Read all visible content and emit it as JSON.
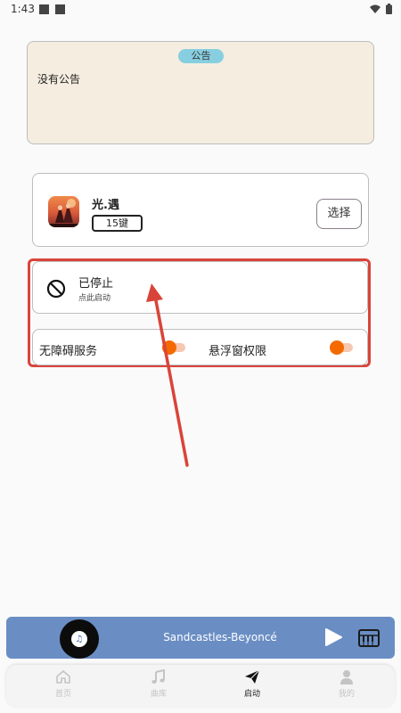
{
  "status_bar": {
    "time": "1:43"
  },
  "notice": {
    "badge": "公告",
    "text": "没有公告"
  },
  "game": {
    "name": "光.遇",
    "keys": "15键",
    "select_label": "选择"
  },
  "service": {
    "title": "已停止",
    "subtitle": "点此启动",
    "state": "stopped"
  },
  "permissions": {
    "accessibility": {
      "label": "无障碍服务",
      "enabled": false
    },
    "overlay": {
      "label": "悬浮窗权限",
      "enabled": false
    }
  },
  "player": {
    "song": "Sandcastles-Beyoncé"
  },
  "nav": {
    "items": [
      {
        "label": "首页",
        "icon": "home-icon",
        "active": false
      },
      {
        "label": "曲库",
        "icon": "music-note-icon",
        "active": false
      },
      {
        "label": "启动",
        "icon": "paper-plane-icon",
        "active": true
      },
      {
        "label": "我的",
        "icon": "person-icon",
        "active": false
      }
    ]
  },
  "colors": {
    "accent_orange": "#f46a00",
    "highlight_red": "#d9443a",
    "player_blue": "#6a8ec4",
    "notice_bg": "#f5ede0",
    "badge_cyan": "#87cfe0"
  }
}
